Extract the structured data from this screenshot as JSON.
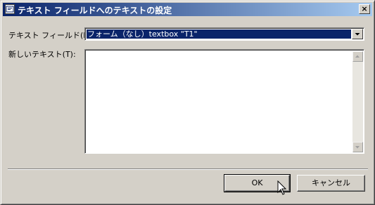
{
  "window": {
    "title": "テキスト フィールドへのテキストの設定",
    "close_symbol": "×"
  },
  "form": {
    "text_field_label": "テキスト フィールド",
    "text_field_accel": "(F):",
    "text_field_value": "フォーム（なし）textbox \"T1\"",
    "new_text_label": "新しいテキスト",
    "new_text_accel": "(T):",
    "new_text_value": ""
  },
  "buttons": {
    "ok_label": "OK",
    "cancel_label": "キャンセル"
  },
  "icons": {
    "title_icon": "dialog-app-icon",
    "close": "close-icon",
    "dropdown": "chevron-down-icon",
    "scroll_up": "scroll-up-arrow-icon",
    "scroll_down": "scroll-down-arrow-icon",
    "cursor": "mouse-pointer-icon"
  }
}
